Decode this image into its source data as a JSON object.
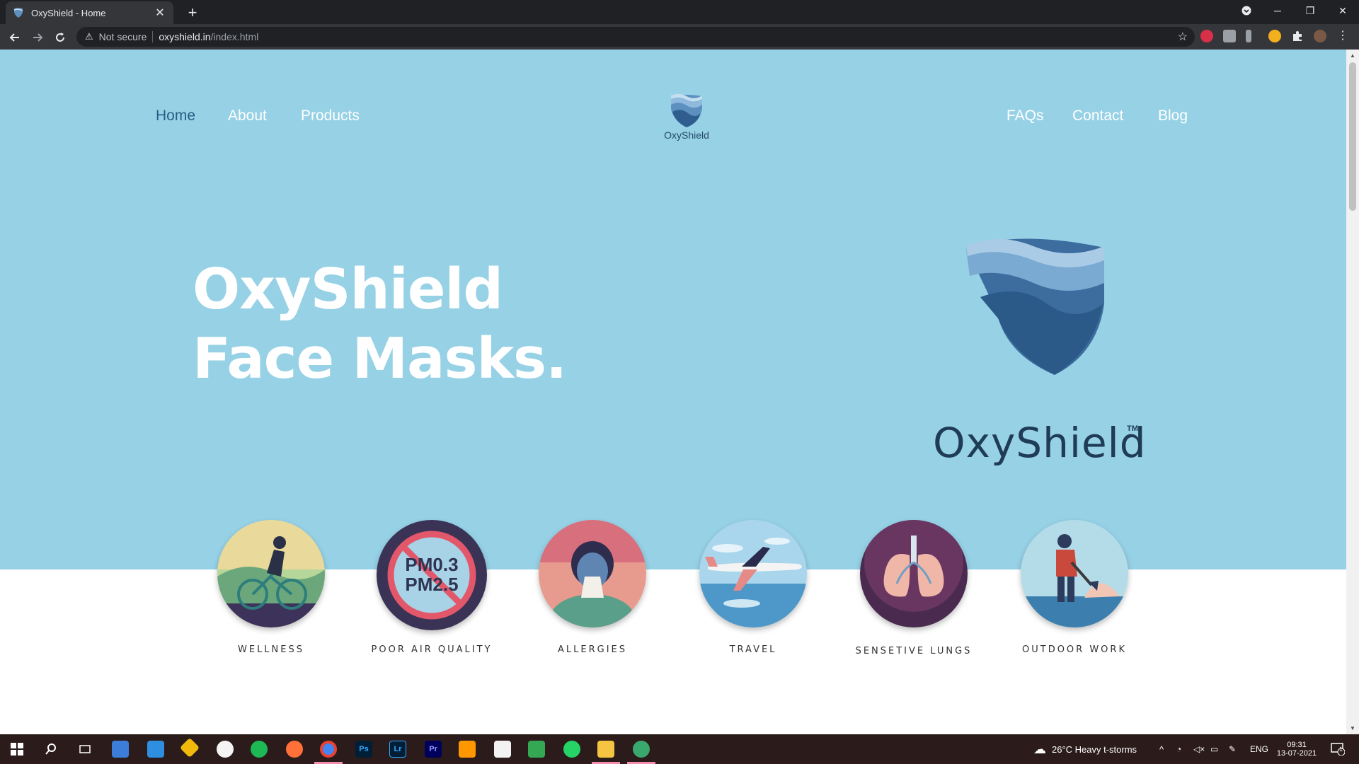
{
  "browser": {
    "tab_title": "OxyShield - Home",
    "new_tab": "+",
    "tab_close": "✕",
    "security_label": "Not secure",
    "url_host": "oxyshield.in",
    "url_path": "/index.html",
    "window_min": "─",
    "window_restore": "❐",
    "window_close": "✕"
  },
  "nav": {
    "left": [
      "Home",
      "About",
      "Products"
    ],
    "right": [
      "FAQs",
      "Contact",
      "Blog"
    ],
    "active": "Home"
  },
  "logo": {
    "small_word": "OxyShield",
    "big_word": "OxyShield",
    "trademark": "TM"
  },
  "hero": {
    "line1": "OxyShield",
    "line2": "Face Masks."
  },
  "features": [
    {
      "label": "WELLNESS",
      "icon": "cyclist-icon"
    },
    {
      "label": "POOR AIR QUALITY",
      "icon": "pm-no-icon",
      "pm1": "PM0.3",
      "pm2": "PM2.5"
    },
    {
      "label": "ALLERGIES",
      "icon": "sneezing-woman-icon"
    },
    {
      "label": "TRAVEL",
      "icon": "airplane-icon"
    },
    {
      "label": "SENSETIVE LUNGS",
      "icon": "lungs-icon"
    },
    {
      "label": "OUTDOOR WORK",
      "icon": "worker-icon"
    }
  ],
  "taskbar": {
    "weather": "26°C  Heavy t-storms",
    "lang": "ENG",
    "time": "09:31",
    "date": "13-07-2021",
    "notif_count": "1",
    "app_ps": "Ps",
    "app_lr": "Lr",
    "app_pr": "Pr"
  },
  "colors": {
    "hero_bg": "#96d1e6",
    "nav_active": "#2a5d82",
    "logo_dark": "#1f3b55"
  }
}
